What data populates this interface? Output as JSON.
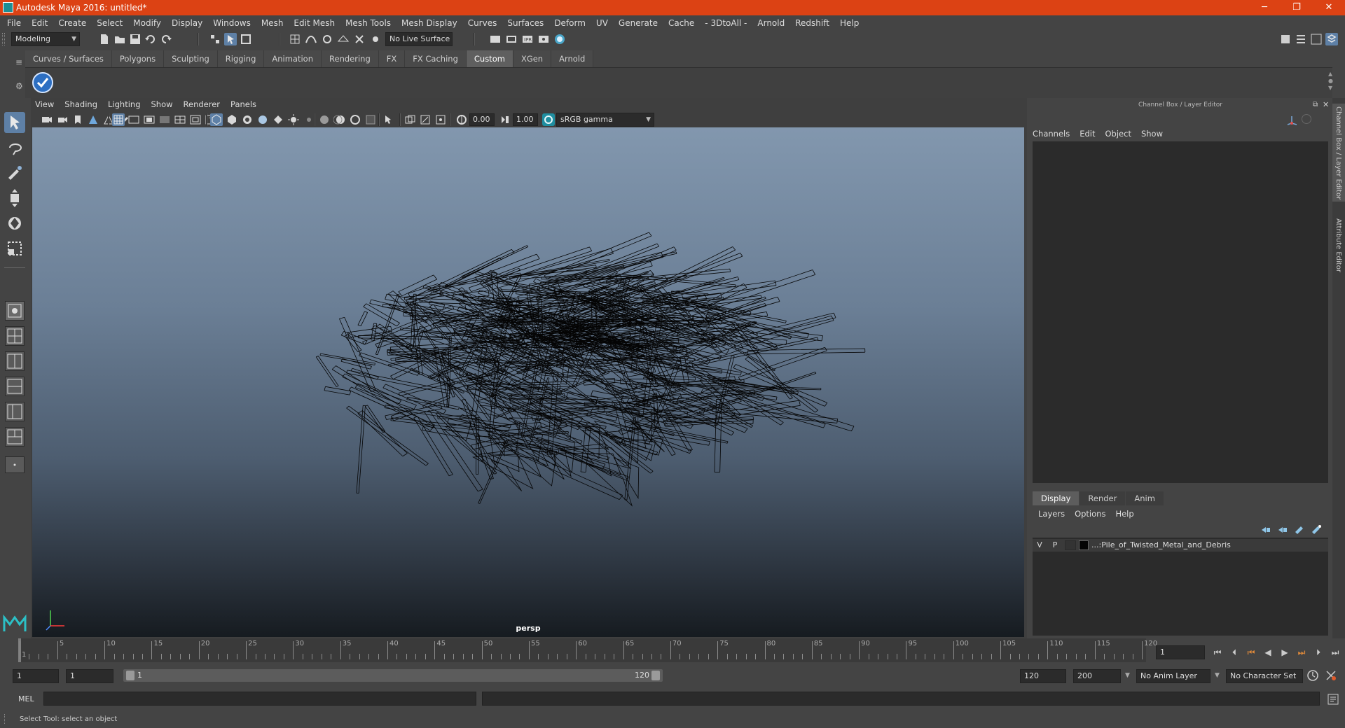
{
  "window": {
    "title": "Autodesk Maya 2016: untitled*",
    "minimize_glyph": "─",
    "maximize_glyph": "❐",
    "close_glyph": "✕"
  },
  "menubar": [
    "File",
    "Edit",
    "Create",
    "Select",
    "Modify",
    "Display",
    "Windows",
    "Mesh",
    "Edit Mesh",
    "Mesh Tools",
    "Mesh Display",
    "Curves",
    "Surfaces",
    "Deform",
    "UV",
    "Generate",
    "Cache",
    "- 3DtoAll -",
    "Arnold",
    "Redshift",
    "Help"
  ],
  "status_line": {
    "mode": "Modeling",
    "live_surface": "No Live Surface"
  },
  "shelf": {
    "tabs": [
      "Curves / Surfaces",
      "Polygons",
      "Sculpting",
      "Rigging",
      "Animation",
      "Rendering",
      "FX",
      "FX Caching",
      "Custom",
      "XGen",
      "Arnold"
    ],
    "active_tab": "Custom"
  },
  "viewport": {
    "menus": [
      "View",
      "Shading",
      "Lighting",
      "Show",
      "Renderer",
      "Panels"
    ],
    "exposure": "0.00",
    "gamma": "1.00",
    "color_space": "sRGB gamma",
    "camera": "persp"
  },
  "channel_box": {
    "header": "Channel Box / Layer Editor",
    "menus": [
      "Channels",
      "Edit",
      "Object",
      "Show"
    ],
    "side_tabs": [
      "Channel Box / Layer Editor",
      "Attribute Editor"
    ]
  },
  "layer_editor": {
    "tabs": [
      "Display",
      "Render",
      "Anim"
    ],
    "active_tab": "Display",
    "menus": [
      "Layers",
      "Options",
      "Help"
    ],
    "layers": [
      {
        "v": "V",
        "p": "P",
        "name": "...:Pile_of_Twisted_Metal_and_Debris"
      }
    ]
  },
  "timeline": {
    "ticks": [
      "1",
      "5",
      "10",
      "15",
      "20",
      "25",
      "30",
      "35",
      "40",
      "45",
      "50",
      "55",
      "60",
      "65",
      "70",
      "75",
      "80",
      "85",
      "90",
      "95",
      "100",
      "105",
      "110",
      "115",
      "120"
    ],
    "current_frame": "1"
  },
  "range": {
    "start": "1",
    "playback_start": "1",
    "slider_start": "1",
    "slider_end": "120",
    "playback_end": "120",
    "end": "200",
    "anim_layer": "No Anim Layer",
    "character_set": "No Character Set"
  },
  "command_line": {
    "label": "MEL"
  },
  "help_line": "Select Tool: select an object",
  "colors": {
    "title_bar": "#dc4214",
    "accent": "#5e80a6",
    "viewport_top": "#8297ae",
    "viewport_bottom": "#161b20"
  }
}
